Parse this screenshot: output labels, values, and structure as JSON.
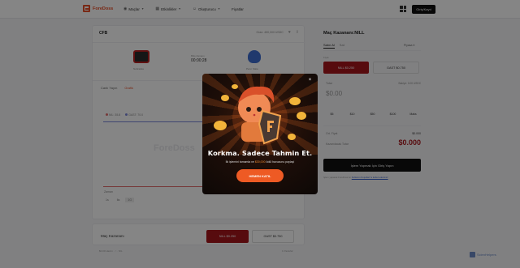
{
  "nav": {
    "brand": "ForeDoss",
    "items": [
      {
        "label": "Maçlar",
        "icon": "globe-icon",
        "has_caret": true
      },
      {
        "label": "Etkinlikler",
        "icon": "grid-icon",
        "has_caret": true
      },
      {
        "label": "Oluşturucu",
        "icon": "user-icon",
        "has_caret": true
      },
      {
        "label": "Fiyatlar",
        "icon": "",
        "has_caret": false
      }
    ],
    "login": "Giriş/Kayıt"
  },
  "match": {
    "league": "CFB",
    "top_right": "Oran: 450,000 USDC",
    "time_label": "Bitiş Zamanı",
    "clock": "00:00:28",
    "team_left": "Nebraska",
    "team_right": "Penn State",
    "tabs": [
      "Canlı Yayın",
      "Grafik"
    ],
    "legend": [
      "NIL: 35.8",
      "GAST: 70.0"
    ],
    "watermark": "ForeDoss",
    "range_label": "Zaman",
    "ranges": [
      "1s",
      "6s",
      "1G"
    ]
  },
  "bottom": {
    "label": "Maç Kazananı",
    "nill": "NILL $0.250",
    "gast": "GAST $0.750",
    "footer_left": "$0.00 Hacim · ○ · NIL",
    "footer_right": "1 Pazarlar"
  },
  "trade": {
    "title": "Maç Kazananı:NILL",
    "tabs": [
      "Satın Al",
      "Sat"
    ],
    "market": "Piyasa",
    "price_label": "Fiyat",
    "nill": "NILL $0.250",
    "gast": "GAST $0.750",
    "amount_label": "Tutar",
    "balance": "Bakiye: 0.00 USDC",
    "amount": "$0.00",
    "chips": [
      "$5",
      "$10",
      "$50",
      "$100",
      "Maks"
    ],
    "avg_label": "Ort. Fiyat",
    "avg_value": "$0.000",
    "win_label": "Kazanılacak Tutar",
    "win_value": "$0.000",
    "login_btn": "İşlem Yapmak İçin Giriş Yapın",
    "terms": "İşlem yaparak ForeDoss'un",
    "terms_link": "Kullanım Koşulları'nı kabul edersiniz"
  },
  "modal": {
    "title": "Korkma. Sadece Tahmin Et.",
    "sub_before": "İlk işlemini tamamla ve",
    "sub_amount": "$30,000",
    "sub_after": "ödül havuzunu paylaş!",
    "cta": "HEMEN KATIL",
    "close": "×"
  },
  "badge": {
    "label": "ScienHelpers"
  },
  "colors": {
    "accent": "#e8502a",
    "nill": "#a8161c",
    "cta": "#ee5a24"
  }
}
